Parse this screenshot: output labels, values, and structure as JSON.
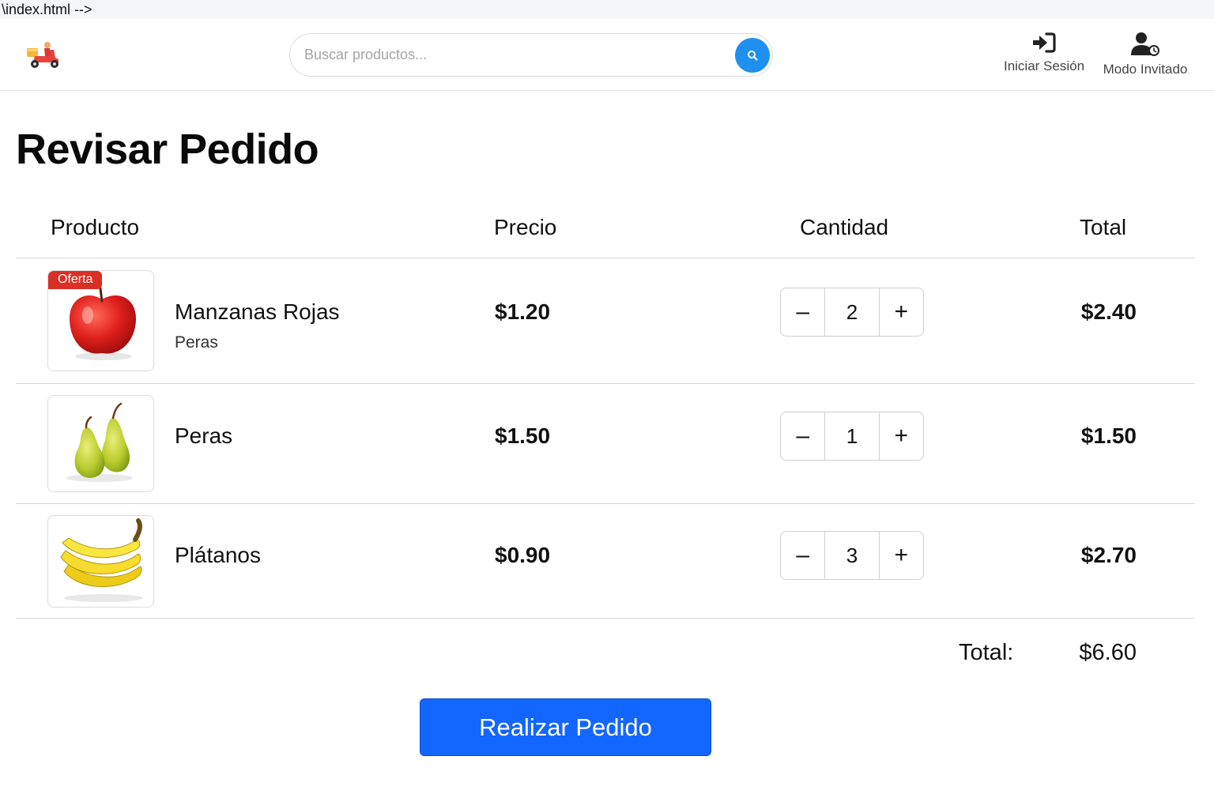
{
  "comment": "\\index.html -->",
  "header": {
    "search": {
      "placeholder": "Buscar productos..."
    },
    "actions": [
      {
        "label": "Iniciar Sesión",
        "icon": "login-icon"
      },
      {
        "label": "Modo Invitado",
        "icon": "guest-user-icon"
      }
    ],
    "accent": "#1e90f0"
  },
  "page": {
    "title": "Revisar Pedido"
  },
  "table": {
    "headers": [
      "Producto",
      "Precio",
      "Cantidad",
      "Total"
    ],
    "rows": [
      {
        "name": "Manzanas Rojas",
        "subtitle": "Peras",
        "badge": "Oferta",
        "image": "apple-image",
        "price": "$1.20",
        "quantity": "2",
        "total": "$2.40"
      },
      {
        "name": "Peras",
        "image": "pears-image",
        "price": "$1.50",
        "quantity": "1",
        "total": "$1.50"
      },
      {
        "name": "Plátanos",
        "image": "bananas-image",
        "price": "$0.90",
        "quantity": "3",
        "total": "$2.70"
      }
    ],
    "decrement": "–",
    "increment": "+"
  },
  "summary": {
    "label": "Total:",
    "value": "$6.60"
  },
  "cta": {
    "label": "Realizar Pedido",
    "color": "#1366ff"
  },
  "badge_color": "#d92f25"
}
